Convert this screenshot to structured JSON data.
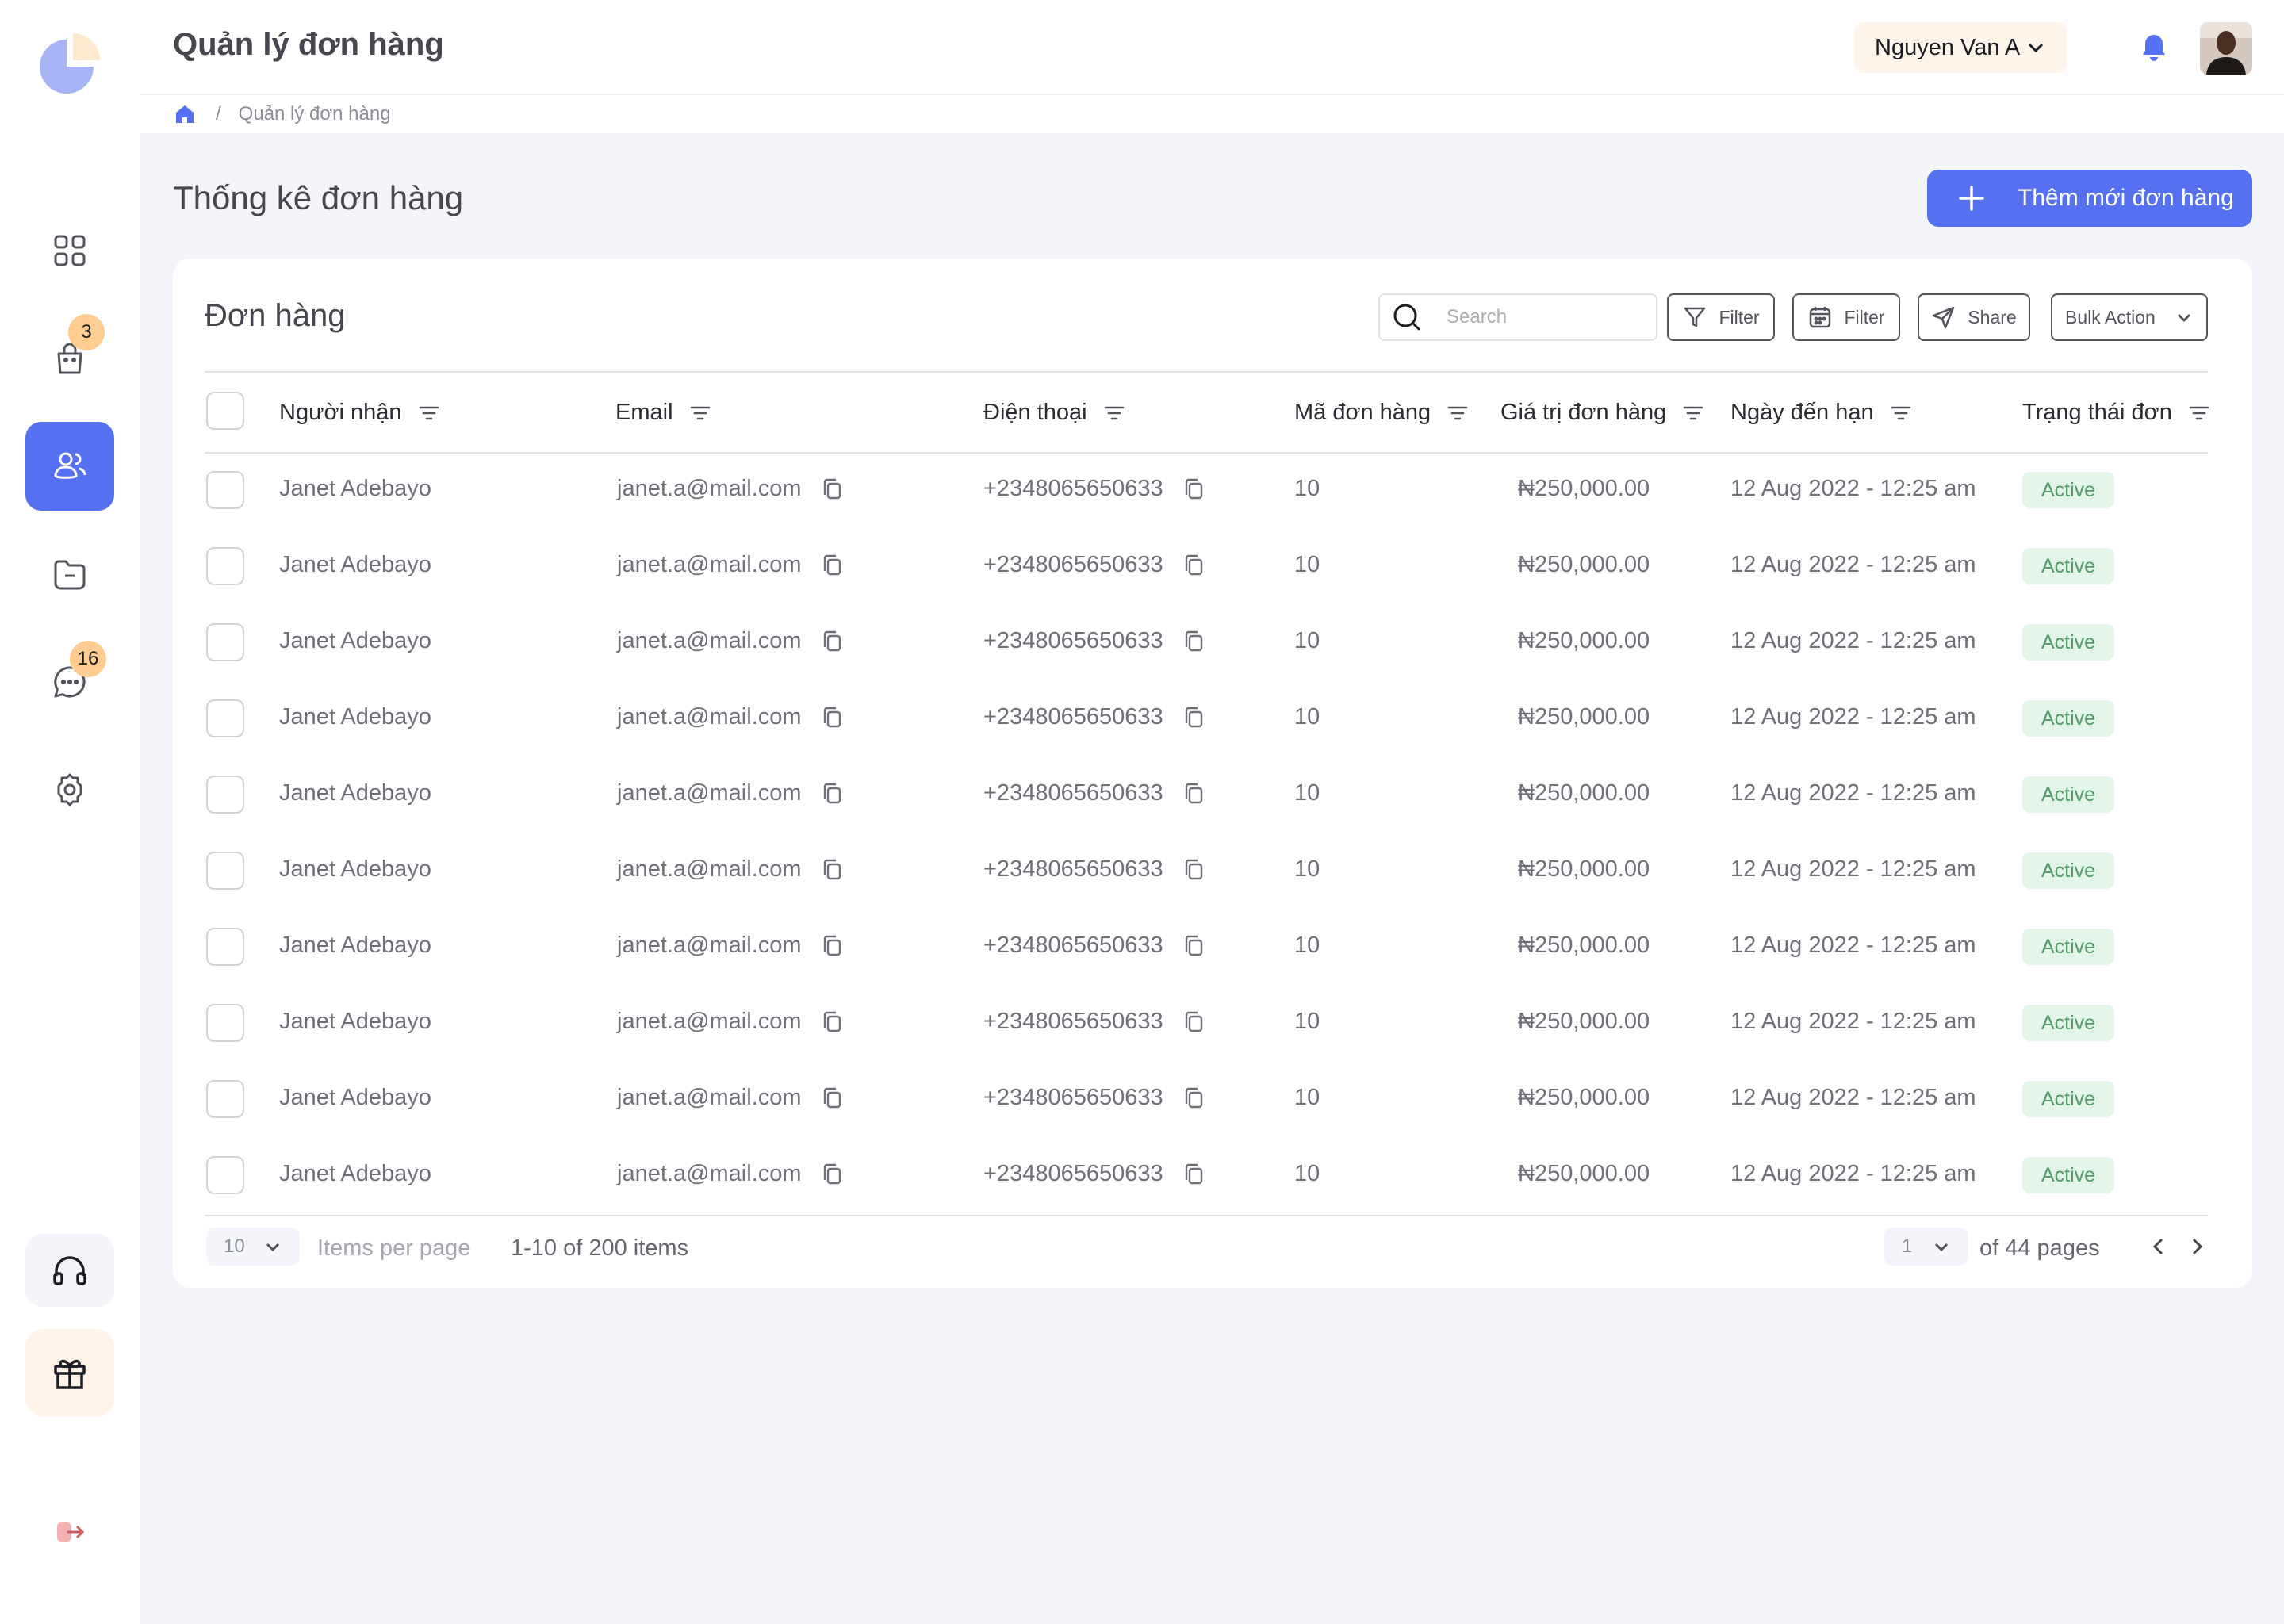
{
  "header": {
    "title": "Quản lý đơn hàng",
    "user_name": "Nguyen Van A"
  },
  "breadcrumb": {
    "current": "Quản lý đơn hàng",
    "separator": "/"
  },
  "sidebar": {
    "cart_badge": "3",
    "messages_badge": "16",
    "icons": [
      "dashboard-icon",
      "bag-icon",
      "customers-icon",
      "folder-icon",
      "chat-icon",
      "settings-icon",
      "headphones-icon",
      "gift-icon",
      "logout-icon"
    ]
  },
  "main": {
    "section_title": "Thống kê đơn hàng",
    "add_button_label": "Thêm mới đơn hàng"
  },
  "table": {
    "title": "Đơn hàng",
    "search_placeholder": "Search",
    "filter_label": "Filter",
    "date_filter_label": "Filter",
    "share_label": "Share",
    "bulk_action_label": "Bulk Action",
    "columns": [
      "Người nhận",
      "Email",
      "Điện thoại",
      "Mã đơn hàng",
      "Giá trị đơn hàng",
      "Ngày đến hạn",
      "Trạng thái đơn"
    ],
    "rows": [
      {
        "name": "Janet Adebayo",
        "email": "janet.a@mail.com",
        "phone": "+2348065650633",
        "order_id": "10",
        "value": "₦250,000.00",
        "due": "12 Aug 2022 - 12:25 am",
        "status": "Active"
      },
      {
        "name": "Janet Adebayo",
        "email": "janet.a@mail.com",
        "phone": "+2348065650633",
        "order_id": "10",
        "value": "₦250,000.00",
        "due": "12 Aug 2022 - 12:25 am",
        "status": "Active"
      },
      {
        "name": "Janet Adebayo",
        "email": "janet.a@mail.com",
        "phone": "+2348065650633",
        "order_id": "10",
        "value": "₦250,000.00",
        "due": "12 Aug 2022 - 12:25 am",
        "status": "Active"
      },
      {
        "name": "Janet Adebayo",
        "email": "janet.a@mail.com",
        "phone": "+2348065650633",
        "order_id": "10",
        "value": "₦250,000.00",
        "due": "12 Aug 2022 - 12:25 am",
        "status": "Active"
      },
      {
        "name": "Janet Adebayo",
        "email": "janet.a@mail.com",
        "phone": "+2348065650633",
        "order_id": "10",
        "value": "₦250,000.00",
        "due": "12 Aug 2022 - 12:25 am",
        "status": "Active"
      },
      {
        "name": "Janet Adebayo",
        "email": "janet.a@mail.com",
        "phone": "+2348065650633",
        "order_id": "10",
        "value": "₦250,000.00",
        "due": "12 Aug 2022 - 12:25 am",
        "status": "Active"
      },
      {
        "name": "Janet Adebayo",
        "email": "janet.a@mail.com",
        "phone": "+2348065650633",
        "order_id": "10",
        "value": "₦250,000.00",
        "due": "12 Aug 2022 - 12:25 am",
        "status": "Active"
      },
      {
        "name": "Janet Adebayo",
        "email": "janet.a@mail.com",
        "phone": "+2348065650633",
        "order_id": "10",
        "value": "₦250,000.00",
        "due": "12 Aug 2022 - 12:25 am",
        "status": "Active"
      },
      {
        "name": "Janet Adebayo",
        "email": "janet.a@mail.com",
        "phone": "+2348065650633",
        "order_id": "10",
        "value": "₦250,000.00",
        "due": "12 Aug 2022 - 12:25 am",
        "status": "Active"
      },
      {
        "name": "Janet Adebayo",
        "email": "janet.a@mail.com",
        "phone": "+2348065650633",
        "order_id": "10",
        "value": "₦250,000.00",
        "due": "12 Aug 2022 - 12:25 am",
        "status": "Active"
      }
    ]
  },
  "pagination": {
    "per_page_value": "10",
    "per_page_label": "Items per page",
    "range_text": "1-10 of 200 items",
    "page_value": "1",
    "pages_text": "of 44 pages"
  },
  "colors": {
    "accent": "#5570f1",
    "badge": "#ffcc91",
    "status_bg": "#e3f4e8",
    "status_text": "#519c66"
  }
}
